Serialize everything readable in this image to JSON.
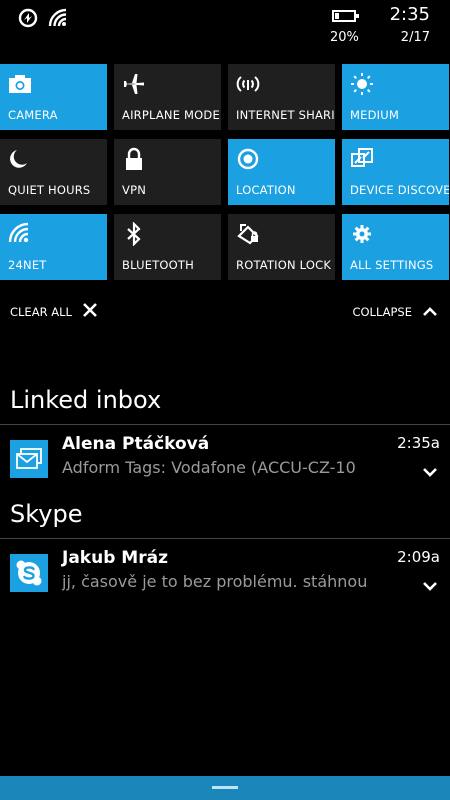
{
  "status_bar": {
    "icons": [
      "data-saver-icon",
      "wifi-signal-icon"
    ],
    "battery_percent": "20%",
    "battery_level": 0.2,
    "time": "2:35",
    "date": "2/17"
  },
  "colors": {
    "accent": "#1ba1e2",
    "tile_off": "#1f1f1f",
    "background": "#000000",
    "secondary_text": "#9a9a9a"
  },
  "quick_actions": [
    {
      "label": "CAMERA",
      "icon": "camera-icon",
      "active": true
    },
    {
      "label": "AIRPLANE MODE",
      "icon": "airplane-icon",
      "active": false
    },
    {
      "label": "INTERNET SHARIN",
      "icon": "internet-sharing-icon",
      "active": false
    },
    {
      "label": "MEDIUM",
      "icon": "brightness-icon",
      "active": true
    },
    {
      "label": "QUIET HOURS",
      "icon": "moon-icon",
      "active": false
    },
    {
      "label": "VPN",
      "icon": "lock-icon",
      "active": false
    },
    {
      "label": "LOCATION",
      "icon": "location-icon",
      "active": true
    },
    {
      "label": "DEVICE DISCOVERY",
      "icon": "device-discovery-icon",
      "active": true
    },
    {
      "label": "24NET",
      "icon": "wifi-icon",
      "active": true
    },
    {
      "label": "BLUETOOTH",
      "icon": "bluetooth-icon",
      "active": false
    },
    {
      "label": "ROTATION LOCK",
      "icon": "rotation-lock-icon",
      "active": false
    },
    {
      "label": "ALL SETTINGS",
      "icon": "gear-icon",
      "active": true
    }
  ],
  "actions": {
    "clear_all": "CLEAR ALL",
    "collapse": "COLLAPSE"
  },
  "notification_groups": [
    {
      "app": "Linked inbox",
      "app_icon": "mail-icon",
      "items": [
        {
          "sender": "Alena Ptáčková",
          "preview": "Adform Tags: Vodafone (ACCU-CZ-10",
          "time": "2:35a"
        }
      ]
    },
    {
      "app": "Skype",
      "app_icon": "skype-icon",
      "items": [
        {
          "sender": "Jakub Mráz",
          "preview": "jj, časově je to bez problému. stáhnou",
          "time": "2:09a"
        }
      ]
    }
  ]
}
